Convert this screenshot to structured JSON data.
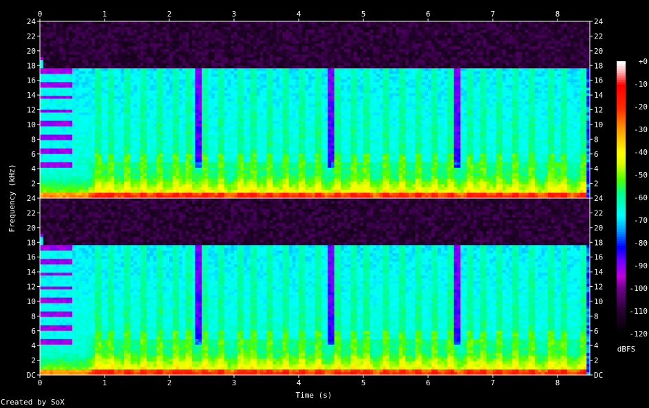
{
  "chart_data": {
    "type": "heatmap",
    "title": "",
    "xlabel": "Time (s)",
    "ylabel": "Frequency (kHz)",
    "x_ticks": [
      0,
      1,
      2,
      3,
      4,
      5,
      6,
      7,
      8
    ],
    "xlim": [
      0,
      8.5
    ],
    "channels": [
      {
        "y_ticks": [
          "24",
          "22",
          "20",
          "18",
          "16",
          "14",
          "12",
          "10",
          "8",
          "6",
          "4",
          "2"
        ],
        "ylim_khz": [
          0,
          24
        ]
      },
      {
        "y_ticks": [
          "24",
          "22",
          "20",
          "18",
          "16",
          "14",
          "12",
          "10",
          "8",
          "6",
          "4",
          "2",
          "DC"
        ],
        "ylim_khz": [
          0,
          24
        ]
      }
    ],
    "colorbar": {
      "unit": "dBFS",
      "ticks": [
        "+0",
        "-10",
        "-20",
        "-30",
        "-40",
        "-50",
        "-60",
        "-70",
        "-80",
        "-90",
        "-100",
        "-110",
        "-120"
      ],
      "range_db": [
        -120,
        0
      ]
    },
    "content_notes": {
      "cutoff_khz": 17,
      "onset_times_s": [
        0.9,
        1.1,
        1.35,
        1.6,
        1.85,
        2.1,
        2.3,
        2.55,
        2.8,
        3.1,
        3.3,
        3.55,
        3.8,
        4.05,
        4.3,
        4.6,
        4.85,
        5.05,
        5.35,
        5.6,
        5.85,
        6.1,
        6.35,
        6.65,
        6.85,
        7.1,
        7.35,
        7.6,
        7.9,
        8.1,
        8.4
      ],
      "gap_times_s": [
        2.45,
        4.5,
        6.45
      ]
    },
    "footer": "Created by SoX"
  },
  "colors": {
    "background": "#000000",
    "axis": "#ffffff",
    "palette": [
      "#000000",
      "#1a0a20",
      "#5a0a70",
      "#c000e0",
      "#6a00ff",
      "#0000ff",
      "#00a0ff",
      "#00ffff",
      "#00ff80",
      "#60ff00",
      "#ffff00",
      "#ffa000",
      "#ff3000",
      "#ff0000",
      "#ffc0c0",
      "#ffffff"
    ]
  }
}
